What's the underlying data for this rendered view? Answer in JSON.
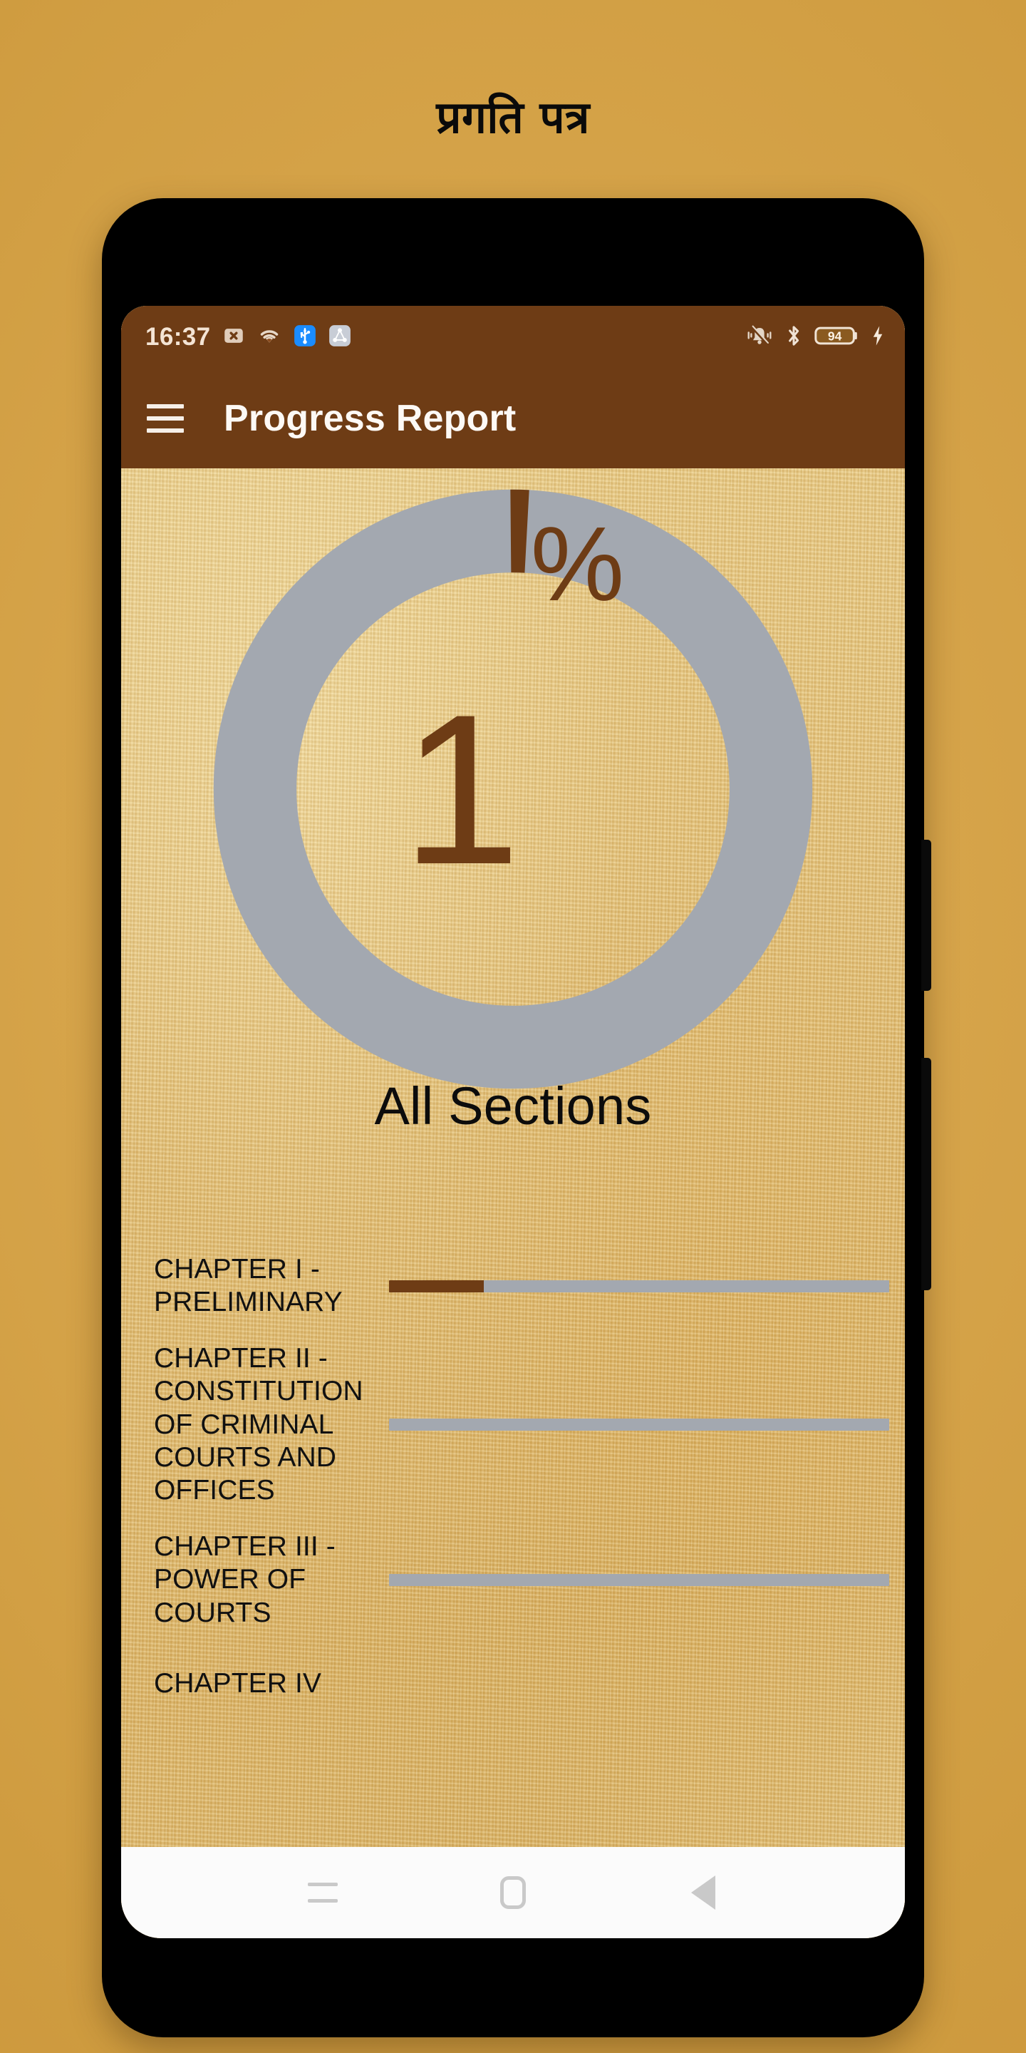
{
  "page": {
    "title": "प्रगति पत्र"
  },
  "status_bar": {
    "clock": "16:37",
    "battery_level": "94",
    "left_icons": [
      "no-sim-icon",
      "wifi-icon",
      "usb-icon",
      "nearby-share-icon"
    ],
    "right_icons": [
      "vibrate-off-icon",
      "bluetooth-icon",
      "battery-icon",
      "charging-bolt-icon"
    ]
  },
  "app_bar": {
    "menu_icon": "hamburger-menu-icon",
    "title": "Progress Report"
  },
  "gauge": {
    "value": "1",
    "unit": "%",
    "percent": 1,
    "track_color": "#a3a8b0",
    "fill_color": "#6e3c15"
  },
  "sections": {
    "heading": "All Sections"
  },
  "chapters": [
    {
      "label": "CHAPTER I - PRELIMINARY",
      "percent": 19
    },
    {
      "label": "CHAPTER II - CONSTITUTION OF CRIMINAL COURTS AND OFFICES",
      "percent": 0
    },
    {
      "label": "CHAPTER III - POWER OF COURTS",
      "percent": 0
    },
    {
      "label": "CHAPTER IV",
      "percent": 0
    }
  ],
  "nav_bar": {
    "recents_label": "recents-icon",
    "home_label": "home-icon",
    "back_label": "back-icon"
  },
  "colors": {
    "brand_brown": "#6e3c15",
    "track_gray": "#a3a8b0",
    "paper": "#e4c178",
    "backdrop": "#d6a44a"
  }
}
